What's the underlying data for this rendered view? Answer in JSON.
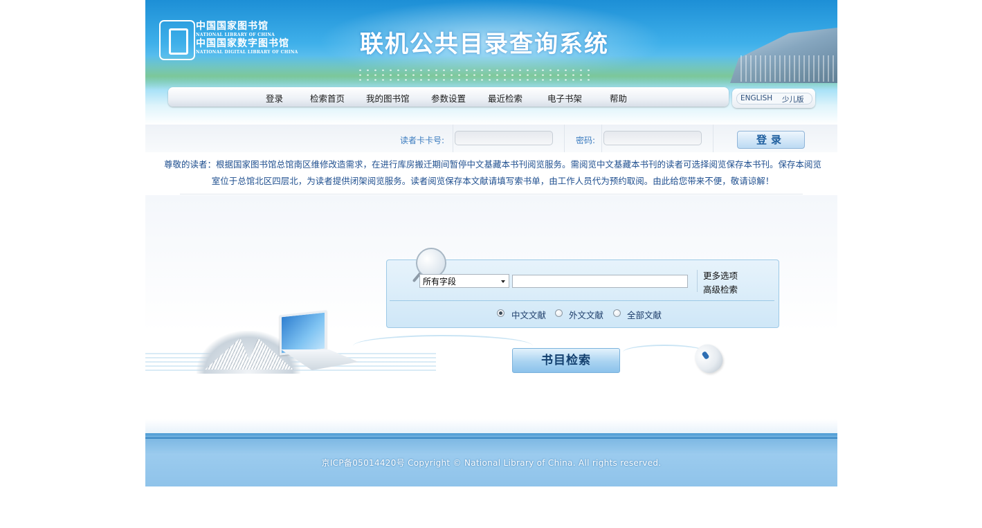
{
  "header": {
    "logo_cn_1": "中国国家图书馆",
    "logo_en_1": "NATIONAL LIBRARY OF CHINA",
    "logo_cn_2": "中国国家数字图书馆",
    "logo_en_2": "NATIONAL DIGITAL LIBRARY OF CHINA",
    "system_title": "联机公共目录查询系统"
  },
  "nav": {
    "items": [
      {
        "label": "登录"
      },
      {
        "label": "检索首页"
      },
      {
        "label": "我的图书馆"
      },
      {
        "label": "参数设置"
      },
      {
        "label": "最近检索"
      },
      {
        "label": "电子书架"
      },
      {
        "label": "帮助"
      }
    ],
    "lang_english": "ENGLISH",
    "lang_kids": "少儿版"
  },
  "login": {
    "card_label": "读者卡卡号:",
    "card_value": "",
    "password_label": "密码:",
    "password_value": "",
    "button": "登录"
  },
  "notice": {
    "text": "尊敬的读者：根据国家图书馆总馆南区维修改造需求，在进行库房搬迁期间暂停中文基藏本书刊阅览服务。需阅览中文基藏本书刊的读者可选择阅览保存本书刊。保存本阅览室位于总馆北区四层北，为读者提供闭架阅览服务。读者阅览保存本文献请填写索书单，由工作人员代为预约取阅。由此给您带来不便，敬请谅解！"
  },
  "search": {
    "field_select": "所有字段",
    "query_value": "",
    "more_options": "更多选项",
    "advanced_search": "高级检索",
    "scopes": [
      {
        "label": "中文文献",
        "selected": true
      },
      {
        "label": "外文文献",
        "selected": false
      },
      {
        "label": "全部文献",
        "selected": false
      }
    ],
    "submit": "书目检索"
  },
  "footer": {
    "text": "京ICP备05014420号   Copyright © National Library of China. All rights reserved."
  },
  "colors": {
    "banner": "#3fb0ea",
    "accent": "#1f5f9f",
    "footer": "#8fc3ea"
  }
}
